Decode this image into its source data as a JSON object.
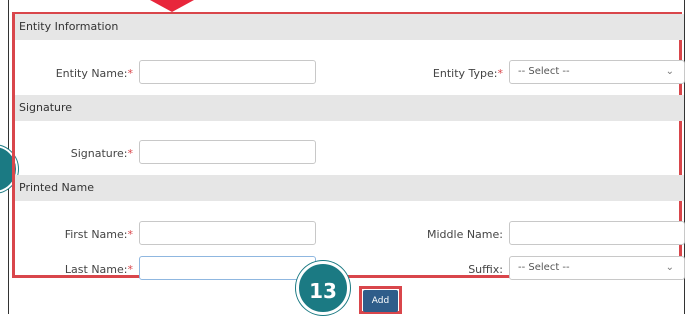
{
  "colors": {
    "highlight_red": "#d9464b",
    "teal_badge": "#1b7a83",
    "button_blue": "#2f5d8a",
    "section_bg": "#e6e6e6"
  },
  "sections": {
    "entity": {
      "title": "Entity Information"
    },
    "signature": {
      "title": "Signature"
    },
    "printed": {
      "title": "Printed Name"
    }
  },
  "fields": {
    "entity_name": {
      "label": "Entity Name:",
      "required": "*",
      "value": ""
    },
    "entity_type": {
      "label": "Entity Type:",
      "required": "*",
      "selected": "-- Select --"
    },
    "signature": {
      "label": "Signature:",
      "required": "*",
      "value": ""
    },
    "first_name": {
      "label": "First Name:",
      "required": "*",
      "value": ""
    },
    "middle_name": {
      "label": "Middle Name:",
      "value": ""
    },
    "last_name": {
      "label": "Last Name:",
      "required": "*",
      "value": ""
    },
    "suffix": {
      "label": "Suffix:",
      "selected": "-- Select --"
    }
  },
  "icons": {
    "chevron": "chevron-down-icon"
  },
  "actions": {
    "add_label": "Add"
  },
  "annotation": {
    "step_number": "13"
  }
}
